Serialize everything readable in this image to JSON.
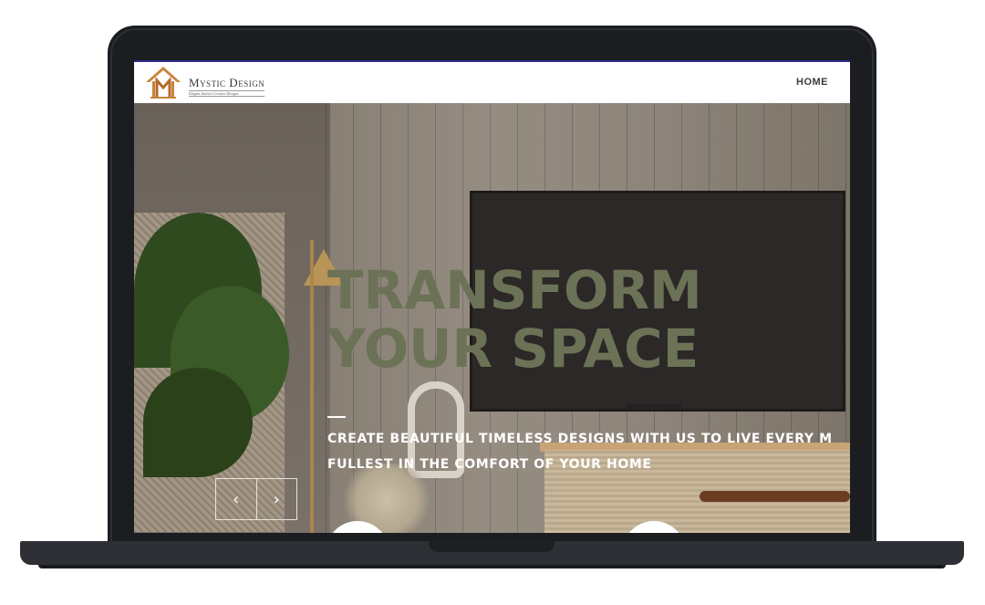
{
  "brand": {
    "name": "Mystic Design",
    "tagline": "Elegant Interior Creative Designs"
  },
  "nav": {
    "home_label": "HOME"
  },
  "hero": {
    "title": "TRANSFORM YOUR SPACE",
    "subtitle_line1": "CREATE BEAUTIFUL TIMELESS DESIGNS WITH US TO LIVE EVERY M",
    "subtitle_line2": "FULLEST IN THE COMFORT OF YOUR HOME",
    "prev_arrow": "‹",
    "next_arrow": "›"
  },
  "colors": {
    "title_green": "#6b7256",
    "logo_orange": "#c9843c",
    "frame": "#1b1d21"
  }
}
